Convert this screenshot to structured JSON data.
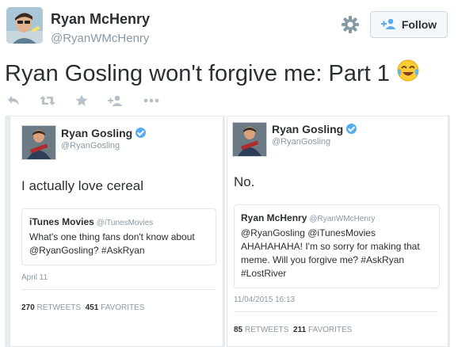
{
  "author": {
    "name": "Ryan McHenry",
    "handle": "@RyanWMcHenry"
  },
  "follow_label": "Follow",
  "tweet": {
    "text": "Ryan Gosling won't forgive me: Part 1",
    "emoji": "😂"
  },
  "actions": [
    "reply-icon",
    "retweet-icon",
    "favorite-icon",
    "follow-icon",
    "more-icon"
  ],
  "left_screenshot": {
    "name": "Ryan Gosling",
    "handle": "@RyanGosling",
    "text": "I actually love cereal",
    "quoted": {
      "name": "iTunes Movies",
      "handle": "@iTunesMovies",
      "text": "What's one thing fans don't know about @RyanGosling? #AskRyan"
    },
    "date": "April 11",
    "retweets": "270",
    "retweets_label": "RETWEETS",
    "favorites": "451",
    "favorites_label": "FAVORITES"
  },
  "right_screenshot": {
    "name": "Ryan Gosling",
    "handle": "@RyanGosling",
    "text": "No.",
    "quoted": {
      "name": "Ryan McHenry",
      "handle": "@RyanWMcHenry",
      "text": "@RyanGosling @iTunesMovies AHAHAHAHA! I'm so sorry for making that meme. Will you forgive me? #AskRyan #LostRiver"
    },
    "date": "11/04/2015 16:13",
    "retweets": "85",
    "retweets_label": "RETWEETS",
    "favorites": "211",
    "favorites_label": "FAVORITES"
  },
  "colors": {
    "accent": "#55acee",
    "text": "#292f33",
    "muted": "#8899a6",
    "icon": "#b6c1c9"
  }
}
